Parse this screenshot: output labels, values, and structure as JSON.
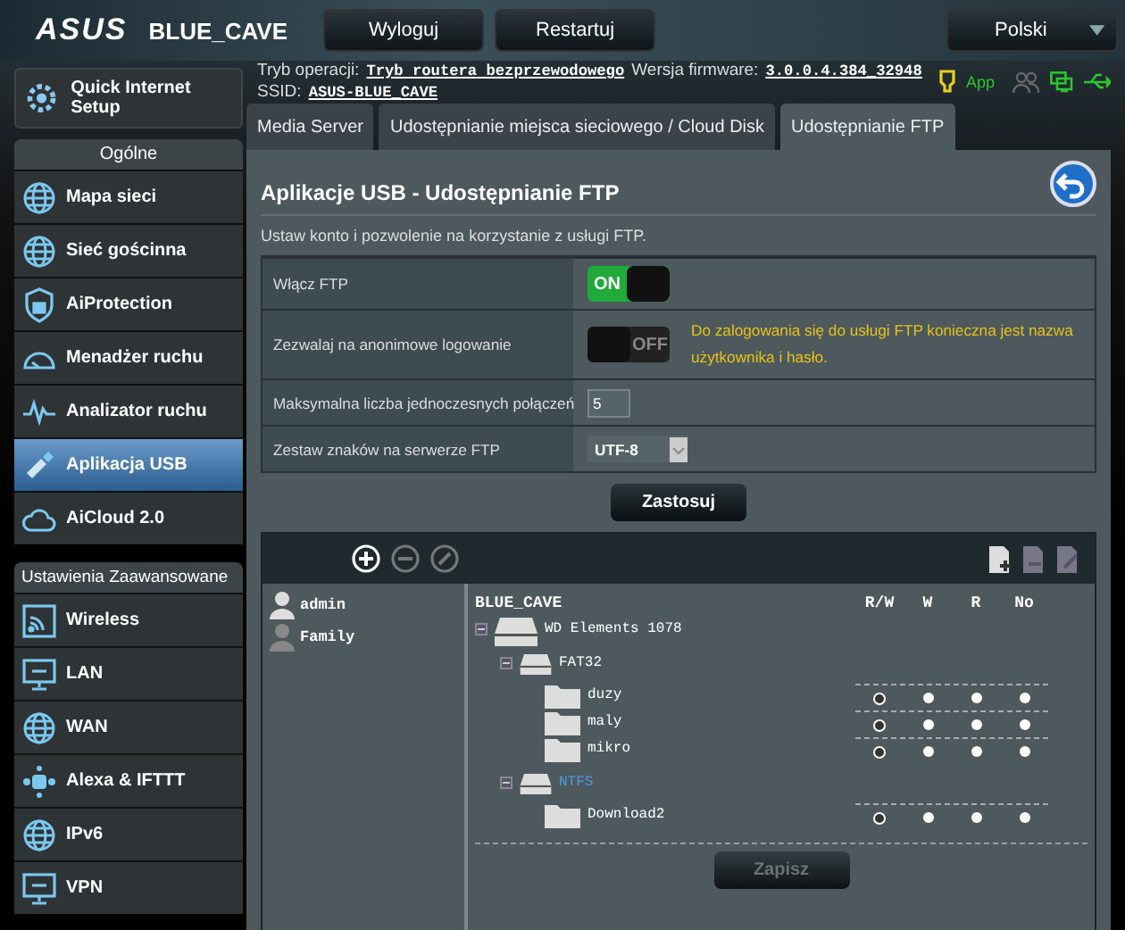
{
  "header": {
    "logo": "ASUS",
    "model": "BLUE_CAVE",
    "buttons": [
      "Wyloguj",
      "Restartuj"
    ],
    "language": "Polski"
  },
  "info": {
    "mode_label": "Tryb operacji:",
    "mode": "Tryb routera bezprzewodowego",
    "firmware_label": "Wersja firmware:",
    "firmware": "3.0.0.4.384_32948",
    "ssid_label": "SSID:",
    "ssid": "ASUS-BLUE_CAVE",
    "app_label": "App"
  },
  "sidebar": {
    "quick_setup": "Quick Internet Setup",
    "sections": [
      {
        "title": "Ogólne",
        "items": [
          {
            "label": "Mapa sieci",
            "selected": false
          },
          {
            "label": "Sieć gościnna",
            "selected": false
          },
          {
            "label": "AiProtection",
            "selected": false
          },
          {
            "label": "Menadżer ruchu",
            "selected": false
          },
          {
            "label": "Analizator ruchu",
            "selected": false
          },
          {
            "label": "Aplikacja USB",
            "selected": true
          },
          {
            "label": "AiCloud 2.0",
            "selected": false
          }
        ]
      },
      {
        "title": "Ustawienia Zaawansowane",
        "items": [
          {
            "label": "Wireless",
            "selected": false
          },
          {
            "label": "LAN",
            "selected": false
          },
          {
            "label": "WAN",
            "selected": false
          },
          {
            "label": "Alexa & IFTTT",
            "selected": false
          },
          {
            "label": "IPv6",
            "selected": false
          },
          {
            "label": "VPN",
            "selected": false
          }
        ]
      }
    ]
  },
  "tabs": [
    {
      "label": "Media Server",
      "selected": false
    },
    {
      "label": "Udostępnianie miejsca sieciowego / Cloud Disk",
      "selected": false
    },
    {
      "label": "Udostępnianie FTP",
      "selected": true
    }
  ],
  "panel": {
    "title": "Aplikacje USB - Udostępnianie FTP",
    "description": "Ustaw konto i pozwolenie na korzystanie z usługi FTP.",
    "settings": [
      {
        "kind": "toggle",
        "label": "Włącz FTP",
        "on": true,
        "switch_text": "ON"
      },
      {
        "kind": "toggle",
        "label": "Zezwalaj na anonimowe logowanie",
        "on": false,
        "switch_text": "OFF",
        "note": "Do zalogowania się do usługi FTP konieczna jest nazwa użytkownika i hasło."
      },
      {
        "kind": "input",
        "label": "Maksymalna liczba jednoczesnych połączeń",
        "value": "5"
      },
      {
        "kind": "select",
        "label": "Zestaw znaków na serwerze FTP",
        "value": "UTF-8"
      }
    ],
    "apply": "Zastosuj"
  },
  "accounts": [
    {
      "name": "admin",
      "selected": true
    },
    {
      "name": "Family",
      "selected": false
    }
  ],
  "share": {
    "root": "BLUE_CAVE",
    "columns": [
      "R/W",
      "W",
      "R",
      "No"
    ],
    "tree": [
      {
        "name": "WD Elements 1078",
        "kind": "disk",
        "expanded": true,
        "children": [
          {
            "name": "FAT32",
            "kind": "partition",
            "expanded": true,
            "selected": false,
            "children": [
              {
                "name": "duzy",
                "kind": "folder",
                "access": [
                  {
                    "selected": true
                  },
                  {
                    "selected": false
                  },
                  {
                    "selected": false
                  },
                  {
                    "selected": false
                  }
                ]
              },
              {
                "name": "maly",
                "kind": "folder",
                "access": [
                  {
                    "selected": true
                  },
                  {
                    "selected": false
                  },
                  {
                    "selected": false
                  },
                  {
                    "selected": false
                  }
                ]
              },
              {
                "name": "mikro",
                "kind": "folder",
                "access": [
                  {
                    "selected": true
                  },
                  {
                    "selected": false
                  },
                  {
                    "selected": false
                  },
                  {
                    "selected": false
                  }
                ]
              }
            ]
          },
          {
            "name": "NTFS",
            "kind": "partition",
            "expanded": true,
            "selected": true,
            "children": [
              {
                "name": "Download2",
                "kind": "folder",
                "access": [
                  {
                    "selected": true
                  },
                  {
                    "selected": false
                  },
                  {
                    "selected": false
                  },
                  {
                    "selected": false
                  }
                ]
              }
            ]
          }
        ]
      }
    ],
    "save": {
      "label": "Zapisz",
      "disabled": true
    }
  }
}
